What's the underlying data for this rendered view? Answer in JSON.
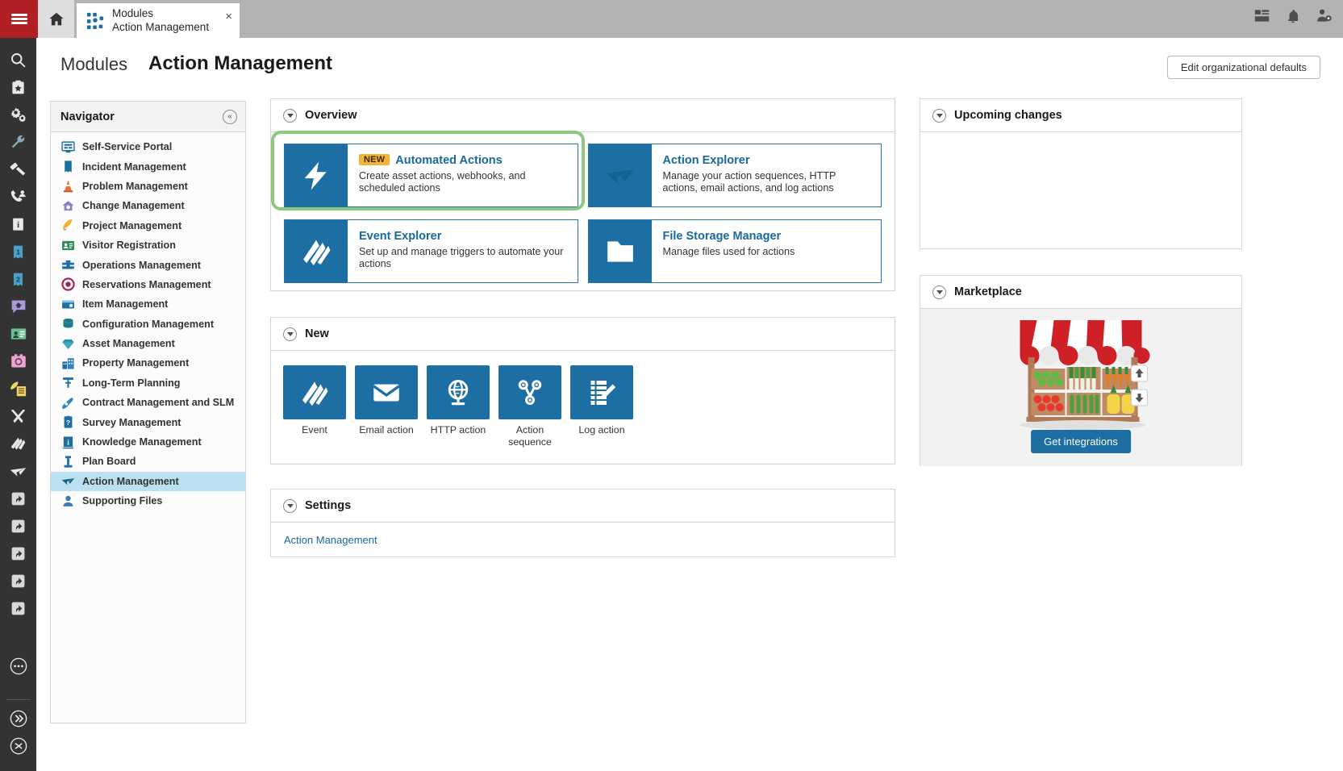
{
  "topbar": {
    "menu_icon": "hamburger-icon",
    "home_icon": "home-icon",
    "tab": {
      "line1": "Modules",
      "line2": "Action Management",
      "close": "×",
      "icon": "modules-icon"
    },
    "right_icons": [
      "layout-icon",
      "bell-icon",
      "user-settings-icon"
    ]
  },
  "rail": {
    "icons": [
      "search-icon",
      "clipboard-star-icon",
      "gears-icon",
      "wrench-icon",
      "paint-roller-icon",
      "phone-support-icon",
      "info-book-icon",
      "ticket-1-icon",
      "ticket-2-icon",
      "chat-home-icon",
      "id-card-icon",
      "camera-time-icon",
      "rocket-list-icon",
      "tools-icon",
      "book-fan-icon",
      "paper-plane-icon",
      "shortcut-1-icon",
      "shortcut-2-icon",
      "shortcut-3-icon",
      "shortcut-4-icon",
      "shortcut-5-icon",
      "more-icon",
      "expand-icon",
      "help-icon"
    ]
  },
  "header": {
    "breadcrumb": "Modules",
    "title": "Action Management",
    "edit_defaults_label": "Edit organizational defaults"
  },
  "navigator": {
    "title": "Navigator",
    "collapse_icon": "collapse-icon",
    "items": [
      {
        "label": "Self-Service Portal",
        "icon": "portal-icon",
        "active": false
      },
      {
        "label": "Incident Management",
        "icon": "incident-icon",
        "active": false
      },
      {
        "label": "Problem Management",
        "icon": "cone-icon",
        "active": false
      },
      {
        "label": "Change Management",
        "icon": "change-icon",
        "active": false
      },
      {
        "label": "Project Management",
        "icon": "rocket-icon",
        "active": false
      },
      {
        "label": "Visitor Registration",
        "icon": "visitor-badge-icon",
        "active": false
      },
      {
        "label": "Operations Management",
        "icon": "toolbox-icon",
        "active": false
      },
      {
        "label": "Reservations Management",
        "icon": "reservations-icon",
        "active": false
      },
      {
        "label": "Item Management",
        "icon": "item-icon",
        "active": false
      },
      {
        "label": "Configuration Management",
        "icon": "cube-icon",
        "active": false
      },
      {
        "label": "Asset Management",
        "icon": "diamond-icon",
        "active": false
      },
      {
        "label": "Property Management",
        "icon": "building-icon",
        "active": false
      },
      {
        "label": "Long-Term Planning",
        "icon": "planning-icon",
        "active": false
      },
      {
        "label": "Contract Management and SLM",
        "icon": "pen-icon",
        "active": false
      },
      {
        "label": "Survey Management",
        "icon": "survey-icon",
        "active": false
      },
      {
        "label": "Knowledge Management",
        "icon": "knowledge-icon",
        "active": false
      },
      {
        "label": "Plan Board",
        "icon": "plan-board-icon",
        "active": false
      },
      {
        "label": "Action Management",
        "icon": "paper-plane-icon",
        "active": true
      },
      {
        "label": "Supporting Files",
        "icon": "person-icon",
        "active": false
      }
    ]
  },
  "overview": {
    "title": "Overview",
    "tiles": [
      {
        "badge": "NEW",
        "title": "Automated Actions",
        "desc": "Create asset actions, webhooks, and scheduled actions",
        "icon": "lightning-bolt-icon",
        "highlighted": true
      },
      {
        "badge": "",
        "title": "Action Explorer",
        "desc": "Manage your action sequences, HTTP actions, email actions, and log actions",
        "icon": "paper-plane-icon",
        "highlighted": false
      },
      {
        "badge": "",
        "title": "Event Explorer",
        "desc": "Set up and manage triggers to automate your actions",
        "icon": "book-fan-icon",
        "highlighted": false
      },
      {
        "badge": "",
        "title": "File Storage Manager",
        "desc": "Manage files used for actions",
        "icon": "folder-icon",
        "highlighted": false
      }
    ]
  },
  "new_section": {
    "title": "New",
    "tiles": [
      {
        "label": "Event",
        "icon": "book-fan-icon"
      },
      {
        "label": "Email action",
        "icon": "envelope-icon"
      },
      {
        "label": "HTTP action",
        "icon": "globe-icon"
      },
      {
        "label": "Action sequence",
        "icon": "node-graph-icon"
      },
      {
        "label": "Log action",
        "icon": "log-edit-icon"
      }
    ]
  },
  "settings": {
    "title": "Settings",
    "link": "Action Management"
  },
  "upcoming": {
    "title": "Upcoming changes",
    "items": []
  },
  "marketplace": {
    "title": "Marketplace",
    "button_label": "Get integrations",
    "illustration": "market-stall-illustration"
  },
  "colors": {
    "brand_red": "#b01f24",
    "tile_blue": "#1d6fa3",
    "link_blue": "#17699e",
    "highlight_green": "#8cc97e",
    "new_badge_yellow": "#f5b335",
    "active_nav": "#bbe0f0"
  }
}
